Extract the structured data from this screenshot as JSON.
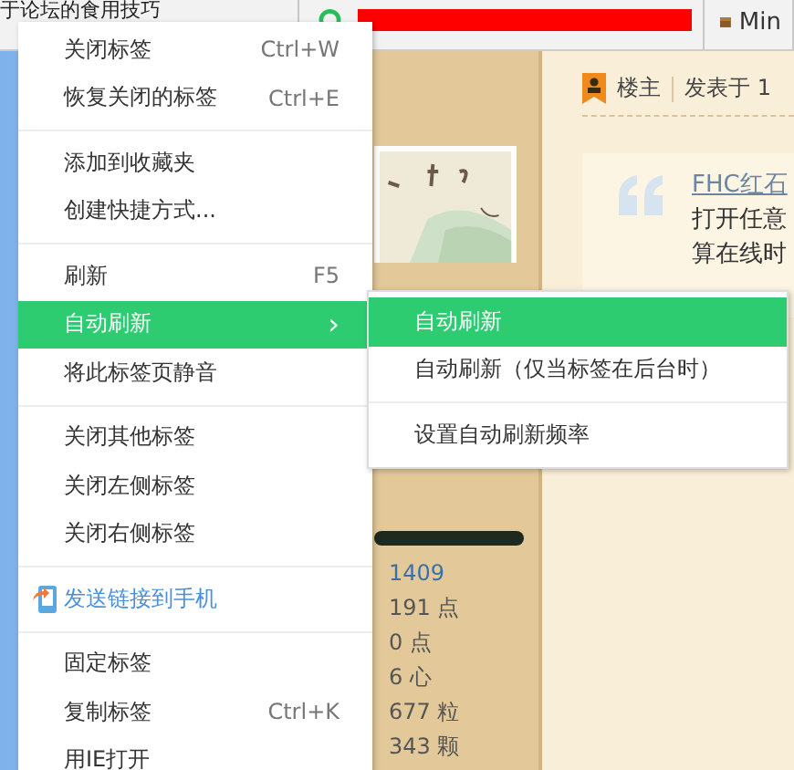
{
  "tabs": [
    {
      "kind": "text",
      "title": "于论坛的食用技巧"
    },
    {
      "kind": "redacted"
    },
    {
      "kind": "text",
      "title": "Min"
    }
  ],
  "post": {
    "author_badge": "楼主",
    "posted": "发表于 1",
    "quote_link": "FHC红石",
    "lines": [
      "打开任意",
      "算在线时"
    ]
  },
  "stats": [
    "1409",
    "191 点",
    "0 点",
    "6 心",
    "677 粒",
    "343 颗"
  ],
  "menu": [
    {
      "kind": "item",
      "label": "关闭标签",
      "shortcut": "Ctrl+W",
      "selected": false
    },
    {
      "kind": "item",
      "label": "恢复关闭的标签",
      "shortcut": "Ctrl+E",
      "selected": false
    },
    {
      "kind": "divider"
    },
    {
      "kind": "item",
      "label": "添加到收藏夹",
      "selected": false
    },
    {
      "kind": "item",
      "label": "创建快捷方式...",
      "selected": false
    },
    {
      "kind": "divider"
    },
    {
      "kind": "item",
      "label": "刷新",
      "shortcut": "F5",
      "selected": false
    },
    {
      "kind": "submenu",
      "label": "自动刷新",
      "arrow": "›",
      "selected": true
    },
    {
      "kind": "item",
      "label": "将此标签页静音",
      "selected": false
    },
    {
      "kind": "divider"
    },
    {
      "kind": "item",
      "label": "关闭其他标签",
      "selected": false
    },
    {
      "kind": "item",
      "label": "关闭左侧标签",
      "selected": false
    },
    {
      "kind": "item",
      "label": "关闭右侧标签",
      "selected": false
    },
    {
      "kind": "divider"
    },
    {
      "kind": "link",
      "label": "发送链接到手机",
      "selected": false
    },
    {
      "kind": "divider"
    },
    {
      "kind": "item",
      "label": "固定标签",
      "selected": false
    },
    {
      "kind": "item",
      "label": "复制标签",
      "shortcut": "Ctrl+K",
      "selected": false
    },
    {
      "kind": "item",
      "label": "用IE打开",
      "selected": false
    }
  ],
  "submenu": [
    {
      "kind": "item",
      "label": "自动刷新",
      "selected": true
    },
    {
      "kind": "item",
      "label": "自动刷新（仅当标签在后台时）",
      "selected": false
    },
    {
      "kind": "divider"
    },
    {
      "kind": "item",
      "label": "设置自动刷新频率",
      "selected": false
    }
  ]
}
